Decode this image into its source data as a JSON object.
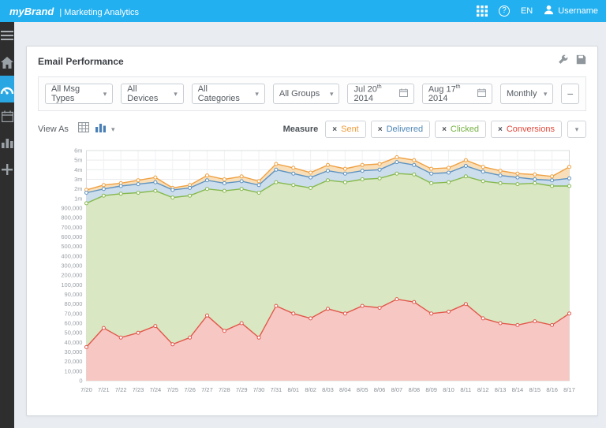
{
  "topbar": {
    "brand": "myBrand",
    "subtitle": "| Marketing Analytics",
    "lang": "EN",
    "username": "Username"
  },
  "card": {
    "title": "Email Performance"
  },
  "filters": {
    "msg_types": "All Msg Types",
    "devices": "All Devices",
    "categories": "All Categories",
    "groups": "All Groups",
    "date_from": {
      "main": "Jul 20",
      "suffix": "th",
      "year": "2014"
    },
    "date_to": {
      "main": "Aug 17",
      "suffix": "th",
      "year": "2014"
    },
    "interval": "Monthly"
  },
  "view_as": {
    "label": "View As"
  },
  "measure": {
    "label": "Measure",
    "chips": [
      {
        "label": "Sent",
        "color": "#ef9b3b"
      },
      {
        "label": "Delivered",
        "color": "#4f87b8"
      },
      {
        "label": "Clicked",
        "color": "#74b042"
      },
      {
        "label": "Conversions",
        "color": "#e0493c"
      }
    ]
  },
  "icons": {
    "close": "×",
    "chevron_down": "▾",
    "minus": "−",
    "help": "?"
  },
  "chart_data": {
    "type": "area",
    "title": "Email Performance",
    "grid": true,
    "legend_position": "top-right",
    "y_scale": "piecewise-equal-ticks",
    "x_labels": [
      "7/20",
      "7/21",
      "7/22",
      "7/23",
      "7/24",
      "7/25",
      "7/26",
      "7/27",
      "7/28",
      "7/29",
      "7/30",
      "7/31",
      "8/01",
      "8/02",
      "8/03",
      "8/04",
      "8/05",
      "8/06",
      "8/07",
      "8/08",
      "8/09",
      "8/10",
      "8/11",
      "8/12",
      "8/13",
      "8/14",
      "8/15",
      "8/16",
      "8/17"
    ],
    "y_ticks": [
      0,
      10000,
      20000,
      30000,
      40000,
      50000,
      60000,
      70000,
      80000,
      90000,
      100000,
      200000,
      300000,
      400000,
      500000,
      600000,
      700000,
      800000,
      900000,
      1000000,
      2000000,
      3000000,
      4000000,
      5000000,
      6000000
    ],
    "y_tick_labels": [
      "0",
      "10,000",
      "20,000",
      "30,000",
      "40,000",
      "50,000",
      "60,000",
      "70,000",
      "80,000",
      "90,000",
      "100,000",
      "200,000",
      "300,000",
      "400,000",
      "500,000",
      "600,000",
      "700,000",
      "800,000",
      "900,000",
      "1m",
      "2m",
      "3m",
      "4m",
      "5m",
      "6m"
    ],
    "series": [
      {
        "name": "Sent",
        "line": "#efa143",
        "fill": "#f8dfba",
        "values": [
          1900000,
          2400000,
          2600000,
          2900000,
          3200000,
          2100000,
          2400000,
          3400000,
          3000000,
          3300000,
          2800000,
          4600000,
          4200000,
          3700000,
          4500000,
          4100000,
          4500000,
          4600000,
          5300000,
          5000000,
          4100000,
          4200000,
          5000000,
          4300000,
          3900000,
          3600000,
          3500000,
          3300000,
          4300000
        ]
      },
      {
        "name": "Delivered",
        "line": "#5e93c1",
        "fill": "#ccddec",
        "values": [
          1600000,
          2000000,
          2300000,
          2500000,
          2700000,
          1900000,
          2100000,
          2900000,
          2600000,
          2800000,
          2400000,
          4000000,
          3600000,
          3200000,
          3900000,
          3600000,
          3900000,
          4000000,
          4800000,
          4500000,
          3600000,
          3700000,
          4400000,
          3800000,
          3400000,
          3200000,
          3000000,
          2900000,
          3100000
        ]
      },
      {
        "name": "Clicked",
        "line": "#86b94e",
        "fill": "#d9e8c2",
        "values": [
          950000,
          1300000,
          1500000,
          1600000,
          1800000,
          1100000,
          1300000,
          2000000,
          1800000,
          2000000,
          1600000,
          2700000,
          2400000,
          2100000,
          2900000,
          2700000,
          3000000,
          3100000,
          3600000,
          3500000,
          2600000,
          2700000,
          3300000,
          2800000,
          2600000,
          2500000,
          2600000,
          2300000,
          2300000
        ]
      },
      {
        "name": "Conversions",
        "line": "#e2574b",
        "fill": "#f7c7c3",
        "values": [
          35000,
          55000,
          45000,
          50000,
          57000,
          38000,
          45000,
          68000,
          52000,
          60000,
          45000,
          78000,
          70000,
          65000,
          75000,
          70000,
          78000,
          76000,
          85000,
          82000,
          70000,
          72000,
          80000,
          65000,
          60000,
          58000,
          62000,
          58000,
          70000
        ]
      }
    ]
  }
}
